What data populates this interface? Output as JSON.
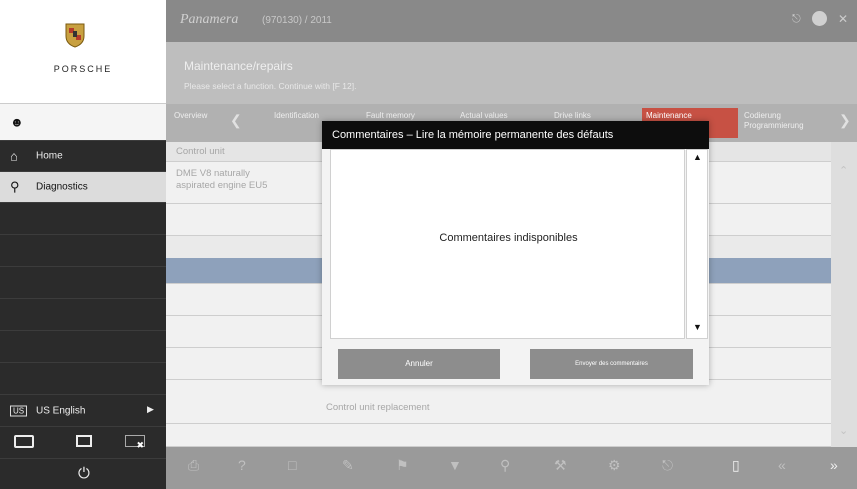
{
  "window": {
    "model_logo": "Panamera",
    "model_code": "(970130) / 2011"
  },
  "header": {
    "title": "Maintenance/repairs",
    "subtitle": "Please select a function. Continue with [F 12]."
  },
  "sidebar": {
    "brand": "PORSCHE",
    "items": [
      {
        "label": "Home",
        "icon": "home-icon"
      },
      {
        "label": "Diagnostics",
        "icon": "diagnostics-icon"
      }
    ],
    "language": "US English"
  },
  "tabs": [
    {
      "label": "Overview"
    },
    {
      "label": "Identification"
    },
    {
      "label": "Fault memory"
    },
    {
      "label": "Actual values"
    },
    {
      "label": "Drive links"
    },
    {
      "label": "Maintenance",
      "active": true
    },
    {
      "label": "Codierung Programmierung"
    }
  ],
  "grid": {
    "header": "Control unit",
    "row1": "DME V8 naturally aspirated engine EU5",
    "row_bottom": "Control unit replacement"
  },
  "dialog": {
    "title": "Commentaires – Lire la mémoire permanente des défauts",
    "message": "Commentaires indisponibles",
    "cancel_label": "Annuler",
    "send_label": "Envoyer des commentaires"
  },
  "colors": {
    "accent": "#c0392b",
    "highlight_row": "#7f95b2",
    "dialog_title_bg": "#0d0d0d"
  }
}
